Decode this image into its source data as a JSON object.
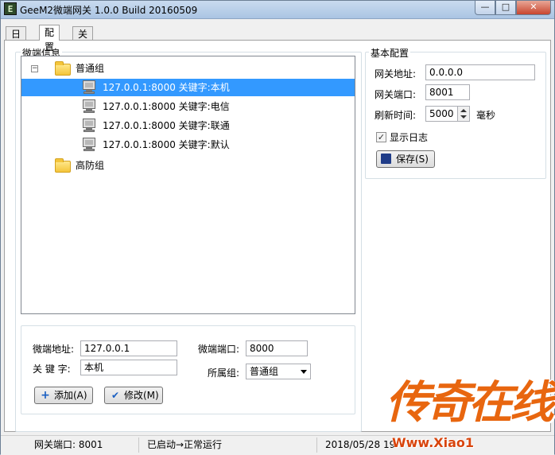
{
  "window": {
    "title": "GeeM2微端网关 1.0.0 Build 20160509",
    "icon_label": "E",
    "min_glyph": "—",
    "max_glyph": "□",
    "close_glyph": "✕"
  },
  "tabs": [
    {
      "label": "日志",
      "active": false
    },
    {
      "label": "配置",
      "active": true
    },
    {
      "label": "关于",
      "active": false
    }
  ],
  "microclient_group": {
    "title": "微端信息",
    "tree": {
      "expander_glyph": "−",
      "groups": [
        {
          "label": "普通组",
          "expanded": true,
          "items": [
            {
              "text": "127.0.0.1:8000 关键字:本机",
              "selected": true
            },
            {
              "text": "127.0.0.1:8000 关键字:电信",
              "selected": false
            },
            {
              "text": "127.0.0.1:8000 关键字:联通",
              "selected": false
            },
            {
              "text": "127.0.0.1:8000 关键字:默认",
              "selected": false
            }
          ]
        },
        {
          "label": "高防组",
          "expanded": false,
          "items": []
        }
      ]
    },
    "form": {
      "address_label": "微端地址:",
      "address_value": "127.0.0.1",
      "port_label": "微端端口:",
      "port_value": "8000",
      "keyword_label": "关 键 字:",
      "keyword_value": "本机",
      "group_label": "所属组:",
      "group_value": "普通组",
      "add_button": "添加(A)",
      "add_icon": "+",
      "modify_button": "修改(M)",
      "modify_icon": "✔"
    }
  },
  "basic_config": {
    "title": "基本配置",
    "gateway_address_label": "网关地址:",
    "gateway_address_value": "0.0.0.0",
    "gateway_port_label": "网关端口:",
    "gateway_port_value": "8001",
    "refresh_label": "刷新时间:",
    "refresh_value": "5000",
    "refresh_unit": "毫秒",
    "show_log_label": "显示日志",
    "show_log_checked": true,
    "check_glyph": "✓",
    "save_button": "保存(S)",
    "save_icon": "💾"
  },
  "statusbar": {
    "gateway_port": "网关端口: 8001",
    "status": "已启动→正常运行",
    "datetime": "2018/05/28 19"
  },
  "watermark": {
    "text": "传奇在线",
    "url": "Www.Xiao1"
  },
  "colors": {
    "selection": "#3399ff",
    "watermark": "#e8660f"
  }
}
